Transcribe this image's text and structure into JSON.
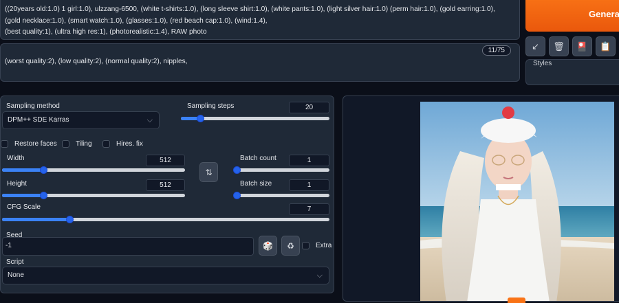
{
  "prompt": {
    "positive_text": "((20years old:1.0) 1 girl:1.0), ulzzang-6500, (white t-shirts:1.0), (long sleeve shirt:1.0), (white pants:1.0), (light silver hair:1.0) (perm hair:1.0), (gold earring:1.0), (gold necklace:1.0), (smart watch:1.0), (glasses:1.0), (red beach cap:1.0), (wind:1.4),\n(best quality:1), (ultra high res:1), (photorealistic:1.4), RAW photo",
    "negative_text": "(worst quality:2), (low quality:2), (normal quality:2), nipples,",
    "negative_token_count": "11/75"
  },
  "toolbar": {
    "generate_label": "Generate",
    "styles_label": "Styles",
    "tools": [
      {
        "icon": "arrow-read-params-icon",
        "glyph": "↙"
      },
      {
        "icon": "trash-icon",
        "glyph": "🗑"
      },
      {
        "icon": "extra-networks-icon",
        "glyph": "🎴"
      },
      {
        "icon": "clipboard-icon",
        "glyph": "📋"
      }
    ]
  },
  "settings": {
    "sampling_method_label": "Sampling method",
    "sampling_method_value": "DPM++ SDE Karras",
    "sampling_steps_label": "Sampling steps",
    "sampling_steps_value": "20",
    "sampling_steps_range": [
      1,
      150
    ],
    "restore_faces_label": "Restore faces",
    "tiling_label": "Tiling",
    "hires_fix_label": "Hires. fix",
    "width_label": "Width",
    "width_value": "512",
    "height_label": "Height",
    "height_value": "512",
    "size_range": [
      64,
      2048
    ],
    "batch_count_label": "Batch count",
    "batch_count_value": "1",
    "batch_size_label": "Batch size",
    "batch_size_value": "1",
    "cfg_scale_label": "CFG Scale",
    "cfg_scale_value": "7",
    "cfg_range": [
      1,
      30
    ],
    "swap_icon": "swap-dimensions-icon",
    "seed_label": "Seed",
    "seed_value": "-1",
    "extra_label": "Extra",
    "script_label": "Script",
    "script_value": "None"
  },
  "colors": {
    "accent": "#2563eb",
    "generate": "#ea580c",
    "background": "#0b0f19"
  }
}
